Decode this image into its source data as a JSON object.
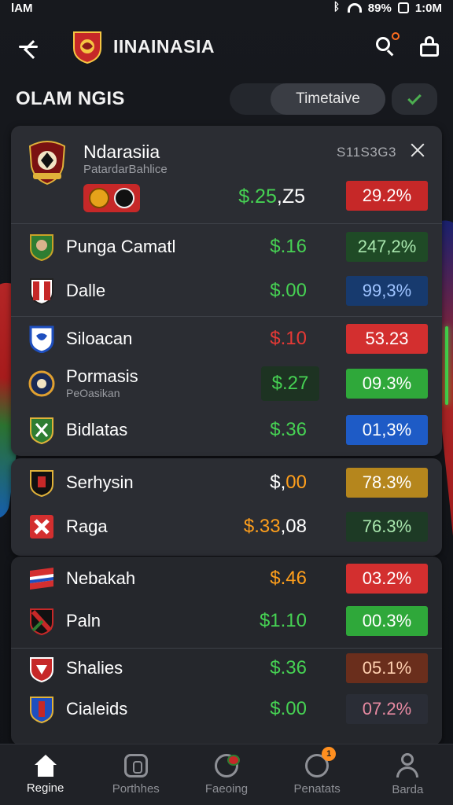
{
  "status": {
    "left": "lAM",
    "battery": "89%",
    "time": "1:0M"
  },
  "appbar": {
    "title": "IINAINASIA"
  },
  "section": {
    "title": "OLAM NGIS",
    "filter": "Timetaive"
  },
  "featured": {
    "name": "Ndarasiia",
    "sub": "PatardarBahlice",
    "code": "S11S3G3",
    "price_green": "$.25",
    "price_white": ",Z5",
    "pct": "29.2%",
    "pct_color": "#c62828"
  },
  "rows": [
    {
      "team": "Punga Camatl",
      "sub": "",
      "price": "$.16",
      "price_color": "#46d153",
      "pct": "247,2%",
      "pct_bg": "#1f4a26",
      "pct_text": "#a8e6ad",
      "crest": "shield-green-icon",
      "boxed": false
    },
    {
      "team": "Dalle",
      "sub": "",
      "price": "$.00",
      "price_color": "#46d153",
      "pct": "99,3%",
      "pct_bg": "#173a6e",
      "pct_text": "#9ec3ff",
      "crest": "shield-red-white-icon",
      "boxed": false
    },
    {
      "team": "Siloacan",
      "sub": "",
      "price": "$.10",
      "price_color": "#e53935",
      "pct": "53.23",
      "pct_bg": "#d32f2f",
      "pct_text": "#ffffff",
      "crest": "shield-blue-icon",
      "boxed": false
    },
    {
      "team": "Pormasis",
      "sub": "PeOasikan",
      "price": "$.27",
      "price_color": "#46d153",
      "pct": "09.3%",
      "pct_bg": "#2fa83a",
      "pct_text": "#ffffff",
      "crest": "round-crest-icon",
      "boxed": true
    },
    {
      "team": "Bidlatas",
      "sub": "",
      "price": "$.36",
      "price_color": "#46d153",
      "pct": "01,3%",
      "pct_bg": "#1e5bc6",
      "pct_text": "#ffffff",
      "crest": "shield-green-red-icon",
      "boxed": false
    },
    {
      "team": "Serhysin",
      "sub": "",
      "price_white": "$,",
      "price": "00",
      "price_color": "#ff9f1c",
      "pct": "78.3%",
      "pct_bg": "#b5861d",
      "pct_text": "#ffffff",
      "crest": "shield-black-gold-icon",
      "boxed": false
    },
    {
      "team": "Raga",
      "sub": "",
      "price": "$.33",
      "price_white": ",08",
      "price_color": "#ff9f1c",
      "pct": "76.3%",
      "pct_bg": "#1d3a25",
      "pct_text": "#a8e6ad",
      "crest": "cross-red-icon",
      "boxed": false
    },
    {
      "team": "Nebakah",
      "sub": "",
      "price": "$.46",
      "price_color": "#ff9f1c",
      "pct": "03.2%",
      "pct_bg": "#d32f2f",
      "pct_text": "#ffffff",
      "crest": "flag-red-blue-icon",
      "boxed": false
    },
    {
      "team": "Paln",
      "sub": "",
      "price": "$1.10",
      "price_color": "#46d153",
      "pct": "00.3%",
      "pct_bg": "#2fa83a",
      "pct_text": "#ffffff",
      "crest": "shield-red-green-icon",
      "boxed": false
    },
    {
      "team": "Shalies",
      "sub": "",
      "price": "$.36",
      "price_color": "#46d153",
      "pct": "05.1%",
      "pct_bg": "#6a2e1c",
      "pct_text": "#ffd0b0",
      "crest": "shield-red-icon",
      "boxed": false
    },
    {
      "team": "Cialeids",
      "sub": "",
      "price": "$.00",
      "price_color": "#46d153",
      "pct": "07.2%",
      "pct_bg": "#2a2d36",
      "pct_text": "#e88aa2",
      "crest": "shield-blue-red-icon",
      "boxed": false
    }
  ],
  "nav": [
    {
      "label": "Regine",
      "icon": "home-icon",
      "active": true
    },
    {
      "label": "Porthhes",
      "icon": "matches-icon",
      "active": false
    },
    {
      "label": "Faeoing",
      "icon": "ball-icon",
      "active": false
    },
    {
      "label": "Penatats",
      "icon": "face-icon",
      "active": false,
      "badge": "1"
    },
    {
      "label": "Barda",
      "icon": "user-icon",
      "active": false
    }
  ]
}
